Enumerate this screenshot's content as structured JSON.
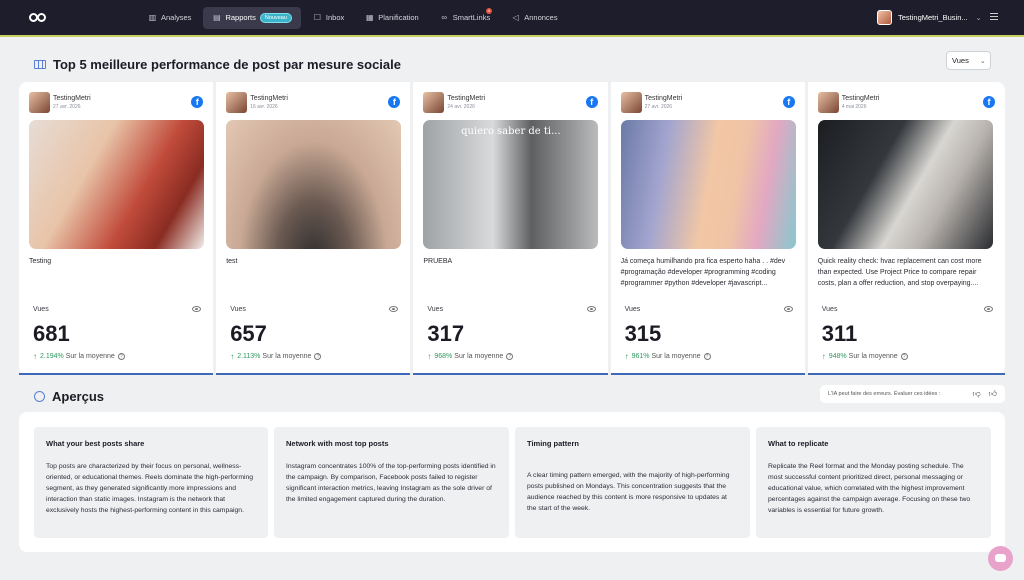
{
  "nav": {
    "items": [
      {
        "label": "Analyses",
        "icon": "chart-icon"
      },
      {
        "label": "Rapports",
        "icon": "reports-icon",
        "badge": "Nouveau",
        "active": true
      },
      {
        "label": "Inbox",
        "icon": "inbox-icon"
      },
      {
        "label": "Planification",
        "icon": "calendar-icon"
      },
      {
        "label": "SmartLinks",
        "icon": "link-icon",
        "dot": "4"
      },
      {
        "label": "Annonces",
        "icon": "megaphone-icon"
      }
    ],
    "account": "TestingMetri_Busin..."
  },
  "top": {
    "title": "Top 5 meilleure performance de post par mesure sociale",
    "select_value": "Vues"
  },
  "cards": [
    {
      "name": "TestingMetri",
      "date": "27 avr. 2026",
      "caption": "Testing",
      "metric_label": "Vues",
      "value": "681",
      "pct": "2.194%",
      "avg": "Sur la moyenne",
      "overlay": ""
    },
    {
      "name": "TestingMetri",
      "date": "16 avr. 2026",
      "caption": "test",
      "metric_label": "Vues",
      "value": "657",
      "pct": "2.113%",
      "avg": "Sur la moyenne",
      "overlay": ""
    },
    {
      "name": "TestingMetri",
      "date": "24 avr. 2026",
      "caption": "PRUEBA",
      "metric_label": "Vues",
      "value": "317",
      "pct": "968%",
      "avg": "Sur la moyenne",
      "overlay": "quiero saber de ti..."
    },
    {
      "name": "TestingMetri",
      "date": "27 avr. 2026",
      "caption": "Já começa humilhando pra fica esperto haha . . #dev #programação #developer #programming #coding #programmer #python #developer #javascript...",
      "metric_label": "Vues",
      "value": "315",
      "pct": "961%",
      "avg": "Sur la moyenne",
      "overlay": ""
    },
    {
      "name": "TestingMetri",
      "date": "4 mai 2026",
      "caption": "Quick reality check: hvac replacement can cost more than expected. Use Project Price to compare repair costs, plan a offer reduction, and stop overpaying....",
      "metric_label": "Vues",
      "value": "311",
      "pct": "948%",
      "avg": "Sur la moyenne",
      "overlay": ""
    }
  ],
  "insights": {
    "title": "Aperçus",
    "disclaimer": "L'IA peut faire des erreurs. Évaluer ces idées :",
    "items": [
      {
        "heading": "What your best posts share",
        "text": "Top posts are characterized by their focus on personal, wellness-oriented, or educational themes. Reels dominate the high-performing segment, as they generated significantly more impressions and interaction than static images. Instagram is the network that exclusively hosts the highest-performing content in this campaign."
      },
      {
        "heading": "Network with most top posts",
        "text": "Instagram concentrates 100% of the top-performing posts identified in the campaign. By comparison, Facebook posts failed to register significant interaction metrics, leaving Instagram as the sole driver of the limited engagement captured during the duration."
      },
      {
        "heading": "Timing pattern",
        "text": "A clear timing pattern emerged, with the majority of high-performing posts published on Mondays. This concentration suggests that the audience reached by this content is more responsive to updates at the start of the week."
      },
      {
        "heading": "What to replicate",
        "text": "Replicate the Reel format and the Monday posting schedule. The most successful content prioritized direct, personal messaging or educational value, which correlated with the highest improvement percentages against the campaign average. Focusing on these two variables is essential for future growth."
      }
    ]
  }
}
